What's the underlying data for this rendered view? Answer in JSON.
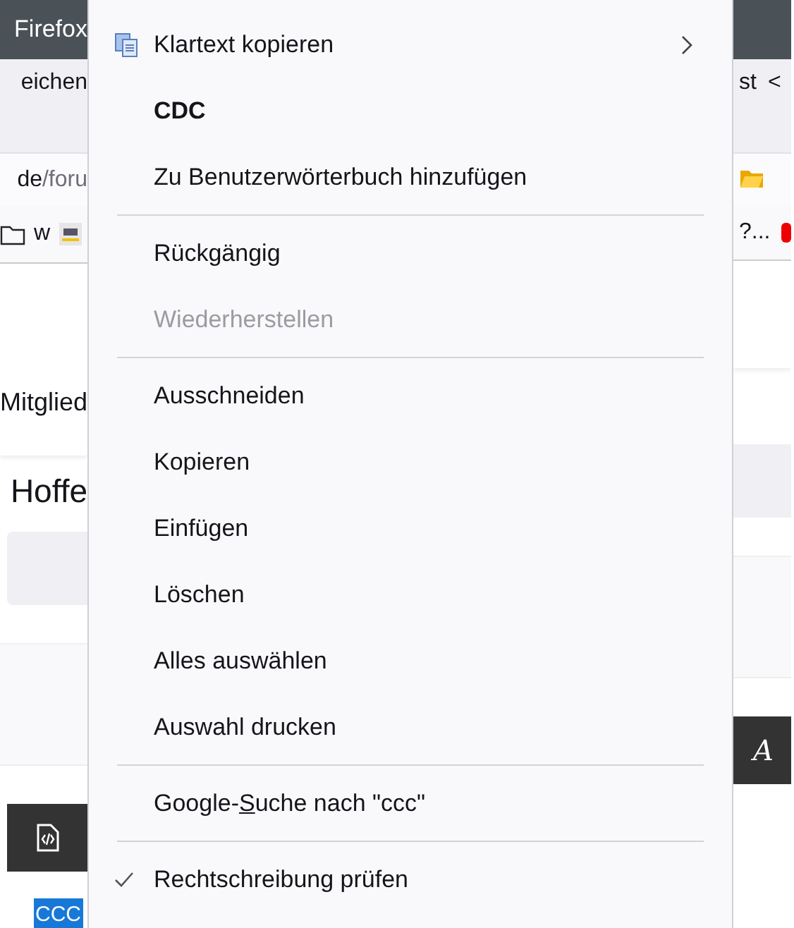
{
  "browser": {
    "title_fragment": "Firefox",
    "menu_fragment_left": "eichen",
    "menu_fragment_right": "st",
    "menu_arrow_right": "<",
    "url_domain": "de",
    "url_path": "/foru",
    "bookmark_left": "w",
    "bookmark_right": "?...",
    "nav_fragment": "Mitglied",
    "heading_fragment": "Hoffe",
    "toolbar_letter": "A",
    "editor_sample": "CCC"
  },
  "context_menu": {
    "items": [
      {
        "kind": "submenu",
        "label": "Klartext kopieren",
        "disabled": false
      },
      {
        "kind": "suggestion",
        "label": "CDC",
        "disabled": false
      },
      {
        "kind": "item",
        "label": "Zu Benutzerwörterbuch hinzufügen",
        "disabled": false
      },
      {
        "kind": "separator"
      },
      {
        "kind": "item",
        "label": "Rückgängig",
        "disabled": false
      },
      {
        "kind": "item",
        "label": "Wiederherstellen",
        "disabled": true
      },
      {
        "kind": "separator"
      },
      {
        "kind": "item",
        "label": "Ausschneiden",
        "disabled": false
      },
      {
        "kind": "item",
        "label": "Kopieren",
        "disabled": false
      },
      {
        "kind": "item",
        "label": "Einfügen",
        "disabled": false
      },
      {
        "kind": "item",
        "label": "Löschen",
        "disabled": false
      },
      {
        "kind": "item",
        "label": "Alles auswählen",
        "disabled": false
      },
      {
        "kind": "item",
        "label": "Auswahl drucken",
        "disabled": false
      },
      {
        "kind": "separator"
      },
      {
        "kind": "item",
        "label": "Google-",
        "access_key": "S",
        "label_rest": "uche nach \"ccc\"",
        "disabled": false
      },
      {
        "kind": "separator"
      },
      {
        "kind": "checkbox",
        "label": "Rechtschreibung prüfen",
        "checked": true,
        "disabled": false
      }
    ]
  }
}
